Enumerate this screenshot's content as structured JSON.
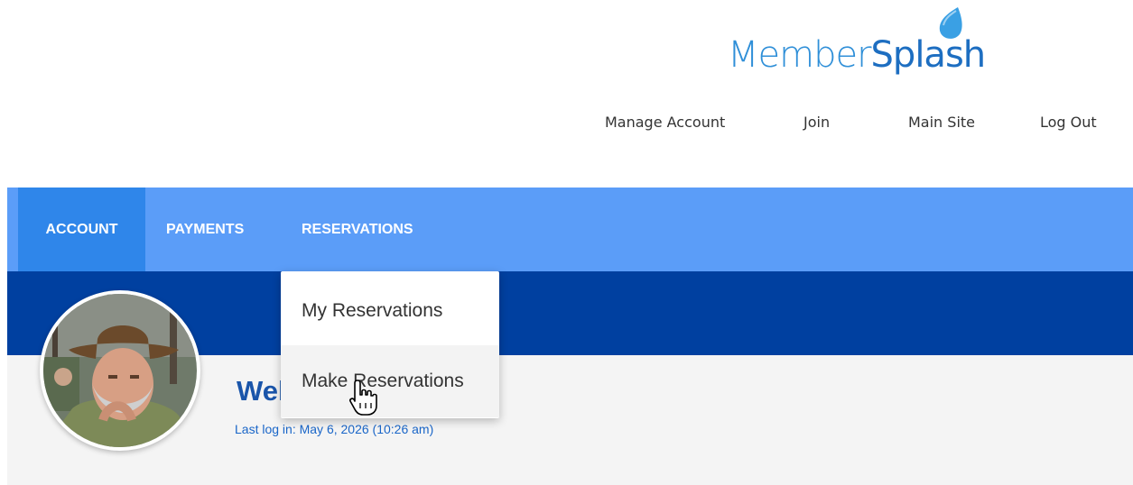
{
  "logo": {
    "word1": "Member",
    "word2": "Splash"
  },
  "top_links": {
    "manage_account": "Manage Account",
    "join": "Join",
    "main_site": "Main Site",
    "log_out": "Log Out"
  },
  "nav": {
    "account": "ACCOUNT",
    "payments": "PAYMENTS",
    "reservations": "RESERVATIONS"
  },
  "dropdown": {
    "my_reservations": "My Reservations",
    "make_reservations": "Make Reservations"
  },
  "profile": {
    "welcome": "Welcome, Shipley",
    "last_login": "Last log in: May 6, 2026 (10:26 am)"
  },
  "colors": {
    "nav_bg": "#5b9df8",
    "nav_active": "#2f86ea",
    "hero_band": "#0040a0",
    "brand_blue": "#1d6ec1"
  }
}
